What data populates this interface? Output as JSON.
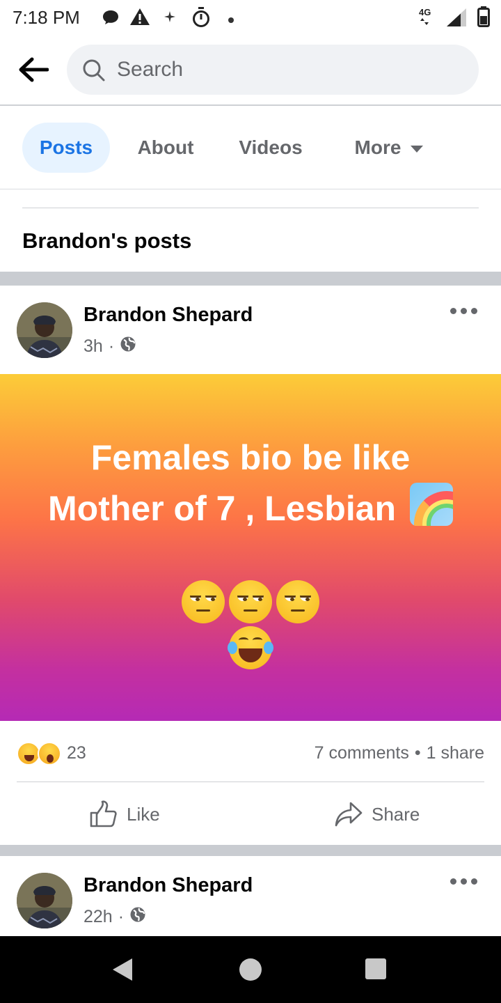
{
  "status_bar": {
    "time": "7:18 PM",
    "network": "4G"
  },
  "search": {
    "placeholder": "Search"
  },
  "tabs": [
    {
      "label": "Posts",
      "active": true
    },
    {
      "label": "About",
      "active": false
    },
    {
      "label": "Videos",
      "active": false
    },
    {
      "label": "More",
      "active": false
    }
  ],
  "section": {
    "title": "Brandon's posts"
  },
  "posts": [
    {
      "author": "Brandon Shepard",
      "time": "3h",
      "privacy_icon": "globe-icon",
      "text_line1": "Females bio be like",
      "text_line2": "Mother of 7 , Lesbian",
      "emoji_line1": "unamused-face unamused-face unamused-face",
      "emoji_line2": "face-with-tears-of-joy",
      "background_gradient": [
        "#fccc38",
        "#fd7447",
        "#b52ab5"
      ],
      "reactions": {
        "icons": [
          "haha-reaction",
          "wow-reaction"
        ],
        "count": "23"
      },
      "comments": "7 comments",
      "shares": "1 share",
      "actions": {
        "like": "Like",
        "share": "Share"
      }
    },
    {
      "author": "Brandon Shepard",
      "time": "22h",
      "privacy_icon": "globe-icon"
    }
  ],
  "colors": {
    "accent": "#1b74e4",
    "tab_active_bg": "#e7f3ff",
    "secondary_text": "#65676b"
  }
}
